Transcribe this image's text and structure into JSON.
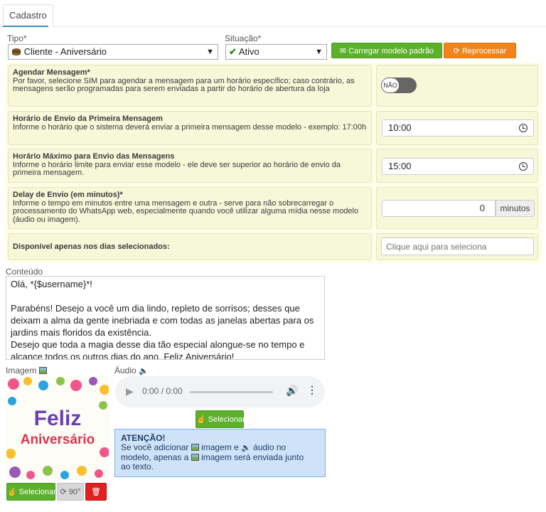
{
  "tab": {
    "label": "Cadastro"
  },
  "tipo": {
    "label": "Tipo*",
    "value": "Cliente - Aniversário"
  },
  "situacao": {
    "label": "Situação*",
    "value": "Ativo"
  },
  "buttons": {
    "load_default": "Carregar modelo padrão",
    "reprocess": "Reprocessar"
  },
  "settings": {
    "schedule": {
      "title": "Agendar Mensagem*",
      "desc": "Por favor, selecione SIM para agendar a mensagem para um horário específico; caso contrário, as mensagens serão programadas para serem enviadas a partir do horário de abertura da loja",
      "toggle_label": "NÃO"
    },
    "first_time": {
      "title": "Horário de Envio da Primeira Mensagem",
      "desc": "Informe o horário que o sistema deverá enviar a primeira mensagem desse modelo - exemplo: 17:00h",
      "value": "10:00"
    },
    "max_time": {
      "title": "Horário Máximo para Envio das Mensagens",
      "desc": "Informe o horário limite para enviar esse modelo - ele deve ser superior ao horário de envio da primeira mensagem.",
      "value": "15:00"
    },
    "delay": {
      "title": "Delay de Envio (em minutos)*",
      "desc": "Informe o tempo em minutos entre uma mensagem e outra - serve para não sobrecarregar o processamento do WhatsApp web, especialmente quando você utilizar alguma mídia nesse modelo (áudio ou imagem).",
      "value": "0",
      "unit": "minutos"
    },
    "days": {
      "title": "Disponível apenas nos dias selecionados:",
      "placeholder": "Clique aqui para seleciona"
    }
  },
  "content": {
    "label": "Conteúdo",
    "text": "Olá, *{$username}*!\n\nParabéns! Desejo a você um dia lindo, repleto de sorrisos; desses que deixam a alma da gente inebriada e com todas as janelas abertas para os jardins mais floridos da existência.\nDesejo que toda a magia desse dia tão especial alongue-se no tempo e alcance todos os outros dias do ano. Feliz Aniversário!"
  },
  "image": {
    "label": "Imagem",
    "card_line1": "Feliz",
    "card_line2": "Aniversário",
    "select": "Selecionar",
    "rotate": "90°"
  },
  "audio": {
    "label": "Áudio",
    "time": "0:00 / 0:00",
    "select": "Selecionar"
  },
  "notice": {
    "title": "ATENÇÃO!",
    "line1_a": "Se você adicionar",
    "line1_b": "imagem e",
    "line1_c": "áudio no",
    "line2_a": "modelo, apenas a",
    "line2_b": "imagem será enviada junto",
    "line3": "ao texto."
  },
  "colors": {
    "green": "#5cb02c",
    "orange": "#f0851b",
    "red": "#e02020",
    "notice_bg": "#cfe3f8"
  }
}
